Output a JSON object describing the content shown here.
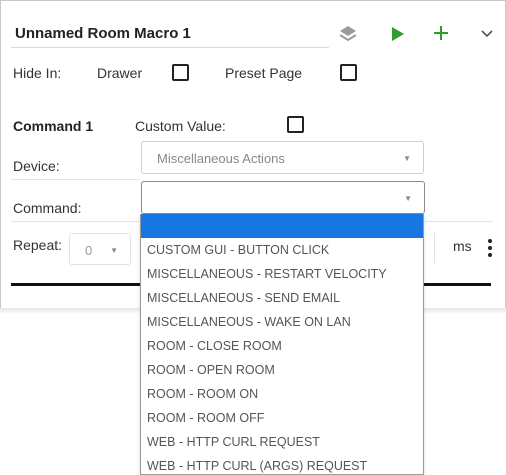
{
  "header": {
    "title": "Unnamed Room Macro 1",
    "icons": [
      "layers-icon",
      "play-icon",
      "plus-icon",
      "chevron-down-icon"
    ],
    "accent_green": "#2e9c2e"
  },
  "hide_in": {
    "label": "Hide In:",
    "drawer_label": "Drawer",
    "preset_label": "Preset Page"
  },
  "command": {
    "heading": "Command 1",
    "custom_value_label": "Custom Value:",
    "device_label": "Device:",
    "device_value": "Miscellaneous Actions",
    "command_label": "Command:",
    "command_value": ""
  },
  "repeat": {
    "label": "Repeat:",
    "value": "0",
    "unit": "ms"
  },
  "dropdown": {
    "highlight_color": "#1876e0",
    "options": [
      "",
      "CUSTOM GUI - BUTTON CLICK",
      "MISCELLANEOUS - RESTART VELOCITY",
      "MISCELLANEOUS - SEND EMAIL",
      "MISCELLANEOUS - WAKE ON LAN",
      "ROOM - CLOSE ROOM",
      "ROOM - OPEN ROOM",
      "ROOM - ROOM ON",
      "ROOM - ROOM OFF",
      "WEB - HTTP CURL REQUEST",
      "WEB - HTTP CURL (ARGS) REQUEST"
    ]
  }
}
